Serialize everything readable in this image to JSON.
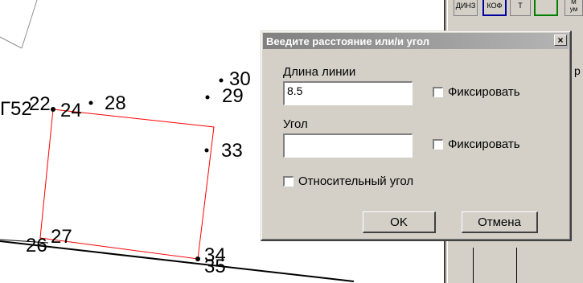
{
  "dialog": {
    "title": "Веедите расстояние или/и угол",
    "close_label": "×",
    "length_label": "Длина линии",
    "length_value": "8.5",
    "fix_label_1": "Фиксировать",
    "angle_label": "Угол",
    "angle_value": "",
    "fix_label_2": "Фиксировать",
    "relative_angle_label": "Относительный угол",
    "ok_label": "OK",
    "cancel_label": "Отмена"
  },
  "map": {
    "labels": {
      "p52": "Г52",
      "p22": "22",
      "p24": "24",
      "p28": "28",
      "p30": "30",
      "p29": "29",
      "p33": "33",
      "p26": "26",
      "p27": "27",
      "p34": "34",
      "p35": "35"
    }
  },
  "toolbar": {
    "btn1": "ДИНЗ",
    "btn2": "КОФ",
    "btn3": "М",
    "btn4": "ум",
    "btn5": "Т",
    "btn6": "р"
  },
  "colors": {
    "polygon": "#ff0000",
    "dialog_bg": "#d4d0c8",
    "title_gradient_start": "#808080",
    "title_gradient_end": "#b5b5b5"
  }
}
